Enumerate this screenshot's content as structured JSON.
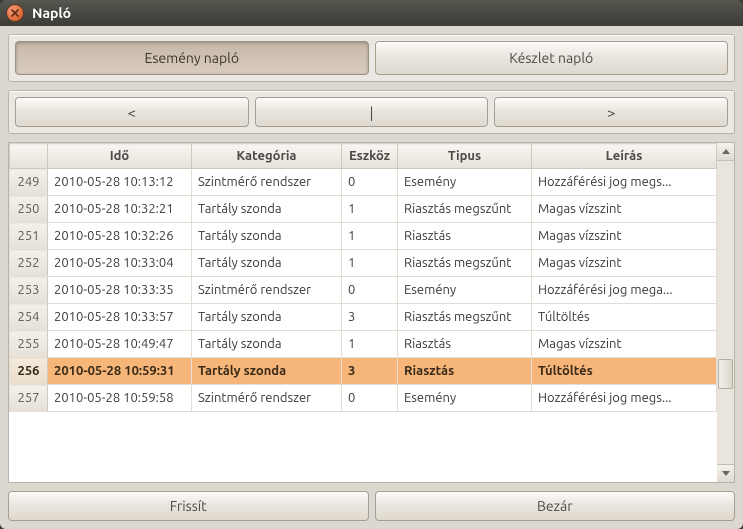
{
  "window": {
    "title": "Napló"
  },
  "tabs": {
    "event": "Esemény napló",
    "stock": "Készlet napló",
    "active": "event"
  },
  "nav": {
    "prev": "<",
    "mid": "|",
    "next": ">"
  },
  "footer": {
    "refresh": "Frissít",
    "close": "Bezár"
  },
  "columns": {
    "num": "",
    "time": "Idő",
    "category": "Kategória",
    "device": "Eszköz",
    "type": "Tipus",
    "desc": "Leírás"
  },
  "selected_row": 256,
  "rows": [
    {
      "n": 249,
      "time": "2010-05-28 10:13:12",
      "cat": "Szintmérő rendszer",
      "dev": "0",
      "type": "Esemény",
      "desc": "Hozzáférési jog megs..."
    },
    {
      "n": 250,
      "time": "2010-05-28 10:32:21",
      "cat": "Tartály szonda",
      "dev": "1",
      "type": "Riasztás megszűnt",
      "desc": "Magas vízszint"
    },
    {
      "n": 251,
      "time": "2010-05-28 10:32:26",
      "cat": "Tartály szonda",
      "dev": "1",
      "type": "Riasztás",
      "desc": "Magas vízszint"
    },
    {
      "n": 252,
      "time": "2010-05-28 10:33:04",
      "cat": "Tartály szonda",
      "dev": "1",
      "type": "Riasztás megszűnt",
      "desc": "Magas vízszint"
    },
    {
      "n": 253,
      "time": "2010-05-28 10:33:35",
      "cat": "Szintmérő rendszer",
      "dev": "0",
      "type": "Esemény",
      "desc": "Hozzáférési jog mega..."
    },
    {
      "n": 254,
      "time": "2010-05-28 10:33:57",
      "cat": "Tartály szonda",
      "dev": "3",
      "type": "Riasztás megszűnt",
      "desc": "Túltöltés"
    },
    {
      "n": 255,
      "time": "2010-05-28 10:49:47",
      "cat": "Tartály szonda",
      "dev": "1",
      "type": "Riasztás",
      "desc": "Magas vízszint"
    },
    {
      "n": 256,
      "time": "2010-05-28 10:59:31",
      "cat": "Tartály szonda",
      "dev": "3",
      "type": "Riasztás",
      "desc": "Túltöltés"
    },
    {
      "n": 257,
      "time": "2010-05-28 10:59:58",
      "cat": "Szintmérő rendszer",
      "dev": "0",
      "type": "Esemény",
      "desc": "Hozzáférési jog megs..."
    }
  ]
}
